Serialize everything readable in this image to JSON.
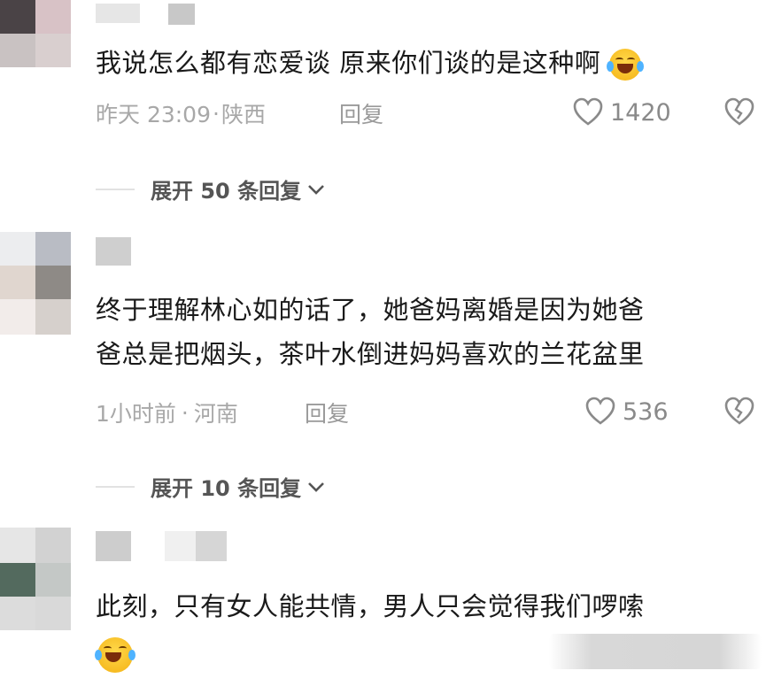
{
  "comments": [
    {
      "text": "我说怎么都有恋爱谈 原来你们谈的是这种啊",
      "time": "昨天 23:09",
      "sep": "·",
      "location": "陕西",
      "reply_label": "回复",
      "likes": "1420",
      "expand_label": "展开 50 条回复",
      "emoji": "laughing-crying-emoji"
    },
    {
      "text_line1": "终于理解林心如的话了，她爸妈离婚是因为她爸",
      "text_line2": "爸总是把烟头，茶叶水倒进妈妈喜欢的兰花盆里",
      "time": "1小时前",
      "sep": "·",
      "location": "河南",
      "reply_label": "回复",
      "likes": "536",
      "expand_label": "展开 10 条回复"
    },
    {
      "text": "此刻，只有女人能共情，男人只会觉得我们啰嗦",
      "emoji": "laughing-crying-emoji"
    }
  ],
  "icons": {
    "like": "heart-outline-icon",
    "dislike": "broken-heart-icon",
    "expand": "chevron-down-icon"
  }
}
